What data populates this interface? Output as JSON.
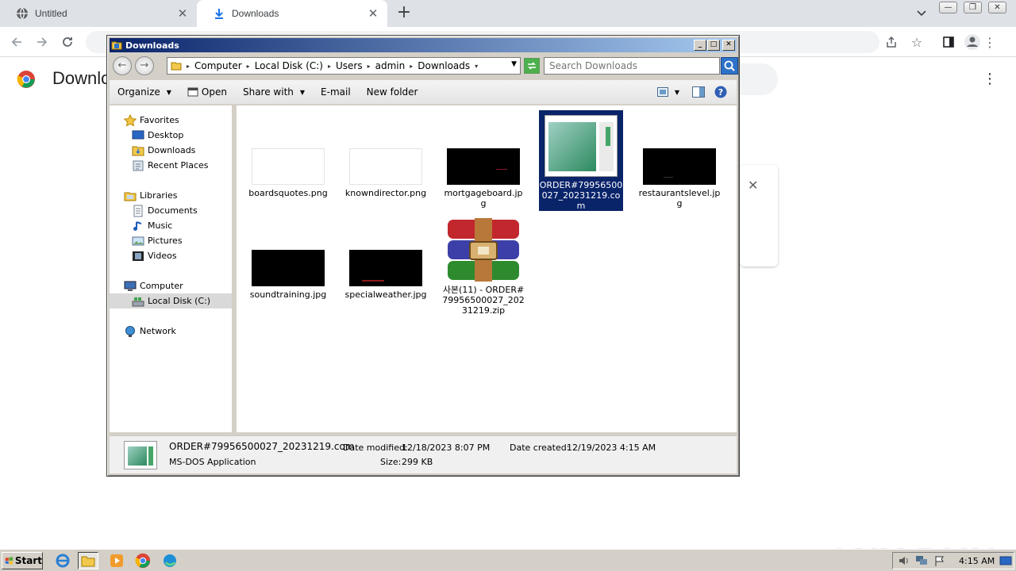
{
  "chrome": {
    "tabs": [
      {
        "title": "Untitled",
        "icon": "globe-icon"
      },
      {
        "title": "Downloads",
        "icon": "download-icon"
      }
    ],
    "new_tab_label": "+",
    "page_title": "Downlo",
    "watermark": "ANY RUN"
  },
  "explorer": {
    "title": "Downloads",
    "breadcrumbs": [
      "Computer",
      "Local Disk (C:)",
      "Users",
      "admin",
      "Downloads"
    ],
    "search_placeholder": "Search Downloads",
    "commands": [
      "Organize",
      "Open",
      "Share with",
      "E-mail",
      "New folder"
    ],
    "nav": {
      "favorites": {
        "label": "Favorites",
        "items": [
          "Desktop",
          "Downloads",
          "Recent Places"
        ]
      },
      "libraries": {
        "label": "Libraries",
        "items": [
          "Documents",
          "Music",
          "Pictures",
          "Videos"
        ]
      },
      "computer": {
        "label": "Computer",
        "items": [
          "Local Disk (C:)"
        ]
      },
      "network": {
        "label": "Network"
      }
    },
    "files": [
      {
        "name": "boardsquotes.png",
        "thumb": "white"
      },
      {
        "name": "knowndirector.png",
        "thumb": "white"
      },
      {
        "name": "mortgageboard.jpg",
        "thumb": "black"
      },
      {
        "name": "ORDER#79956500027_20231219.com",
        "thumb": "app",
        "selected": true
      },
      {
        "name": "restaurantslevel.jpg",
        "thumb": "black"
      },
      {
        "name": "soundtraining.jpg",
        "thumb": "black"
      },
      {
        "name": "specialweather.jpg",
        "thumb": "black"
      },
      {
        "name": "사본(11) - ORDER#79956500027_20231219.zip",
        "thumb": "rar"
      }
    ],
    "status": {
      "filename": "ORDER#79956500027_20231219.com",
      "type": "MS-DOS Application",
      "modified_label": "Date modified:",
      "modified_value": "12/18/2023 8:07 PM",
      "created_label": "Date created:",
      "created_value": "12/19/2023 4:15 AM",
      "size_label": "Size:",
      "size_value": "299 KB"
    }
  },
  "taskbar": {
    "start_label": "Start",
    "clock": "4:15 AM"
  }
}
